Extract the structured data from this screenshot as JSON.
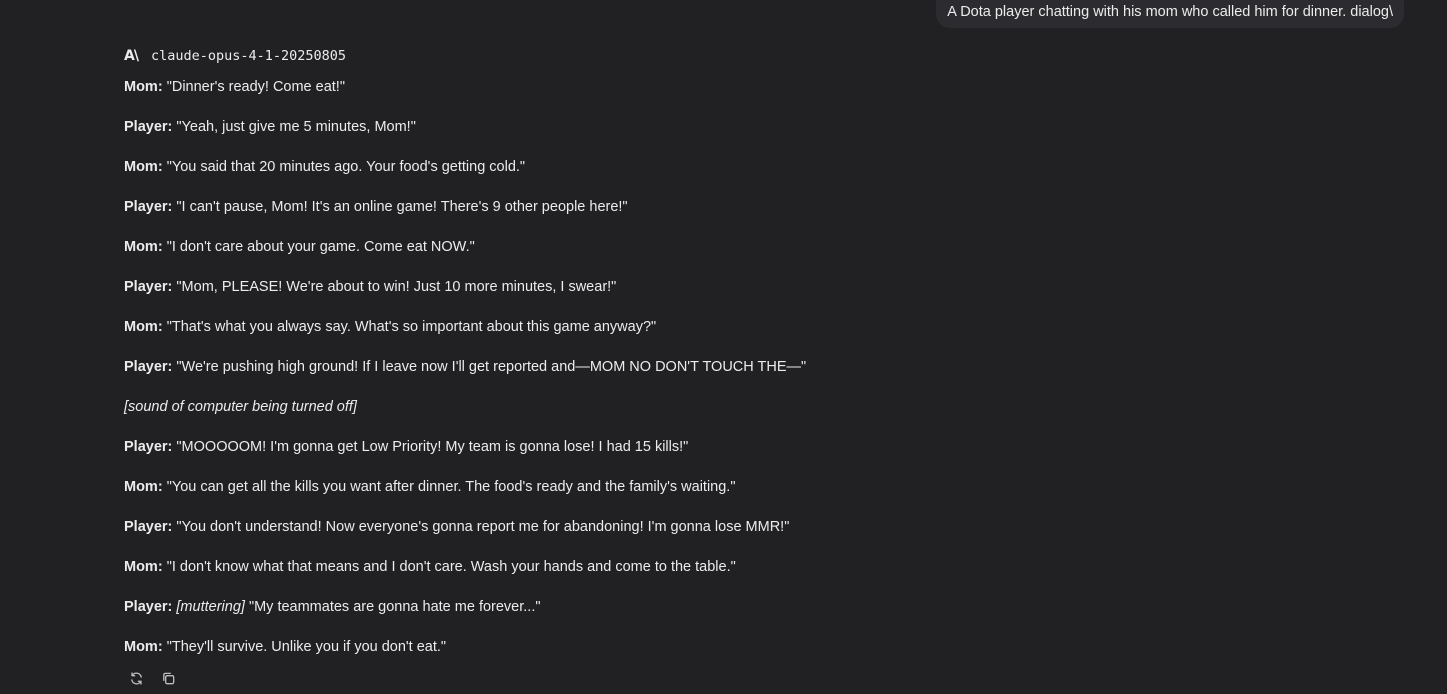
{
  "user_prompt": "A Dota player chatting with his mom who called him for dinner. dialog\\",
  "model": {
    "logo_text": "A\\",
    "name": "claude-opus-4-1-20250805"
  },
  "dialogue": [
    {
      "speaker": "Mom:",
      "direction": "",
      "text": "\"Dinner's ready! Come eat!\""
    },
    {
      "speaker": "Player:",
      "direction": "",
      "text": "\"Yeah, just give me 5 minutes, Mom!\""
    },
    {
      "speaker": "Mom:",
      "direction": "",
      "text": "\"You said that 20 minutes ago. Your food's getting cold.\""
    },
    {
      "speaker": "Player:",
      "direction": "",
      "text": "\"I can't pause, Mom! It's an online game! There's 9 other people here!\""
    },
    {
      "speaker": "Mom:",
      "direction": "",
      "text": "\"I don't care about your game. Come eat NOW.\""
    },
    {
      "speaker": "Player:",
      "direction": "",
      "text": "\"Mom, PLEASE! We're about to win! Just 10 more minutes, I swear!\""
    },
    {
      "speaker": "Mom:",
      "direction": "",
      "text": "\"That's what you always say. What's so important about this game anyway?\""
    },
    {
      "speaker": "Player:",
      "direction": "",
      "text": "\"We're pushing high ground! If I leave now I'll get reported and—MOM NO DON'T TOUCH THE—\""
    },
    {
      "speaker": "",
      "direction": "[sound of computer being turned off]",
      "text": ""
    },
    {
      "speaker": "Player:",
      "direction": "",
      "text": "\"MOOOOOM! I'm gonna get Low Priority! My team is gonna lose! I had 15 kills!\""
    },
    {
      "speaker": "Mom:",
      "direction": "",
      "text": "\"You can get all the kills you want after dinner. The food's ready and the family's waiting.\""
    },
    {
      "speaker": "Player:",
      "direction": "",
      "text": "\"You don't understand! Now everyone's gonna report me for abandoning! I'm gonna lose MMR!\""
    },
    {
      "speaker": "Mom:",
      "direction": "",
      "text": "\"I don't know what that means and I don't care. Wash your hands and come to the table.\""
    },
    {
      "speaker": "Player:",
      "direction": "[muttering]",
      "text": "\"My teammates are gonna hate me forever...\""
    },
    {
      "speaker": "Mom:",
      "direction": "",
      "text": "\"They'll survive. Unlike you if you don't eat.\""
    }
  ],
  "actions": [
    {
      "icon": "retry-icon"
    },
    {
      "icon": "copy-icon"
    }
  ]
}
